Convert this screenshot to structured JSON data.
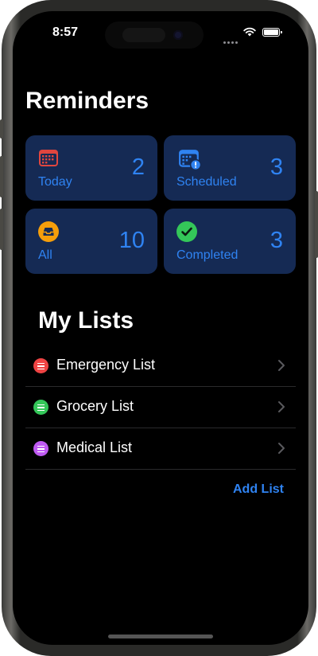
{
  "status": {
    "time": "8:57"
  },
  "title": "Reminders",
  "summary": [
    {
      "label": "Today",
      "count": "2",
      "icon": "calendar-icon",
      "color": "#e0463f"
    },
    {
      "label": "Scheduled",
      "count": "3",
      "icon": "calendar-clock-icon",
      "color": "#2f83f2"
    },
    {
      "label": "All",
      "count": "10",
      "icon": "tray-icon",
      "color": "#f59e0b"
    },
    {
      "label": "Completed",
      "count": "3",
      "icon": "checkmark-icon",
      "color": "#34c759"
    }
  ],
  "my_lists": {
    "title": "My Lists",
    "items": [
      {
        "name": "Emergency List",
        "color": "#ef4444"
      },
      {
        "name": "Grocery List",
        "color": "#34c759"
      },
      {
        "name": "Medical List",
        "color": "#bf5af2"
      }
    ],
    "add_label": "Add List"
  },
  "theme": {
    "accent": "#2f83f2",
    "card_bg": "#152a54",
    "background": "#000000"
  }
}
